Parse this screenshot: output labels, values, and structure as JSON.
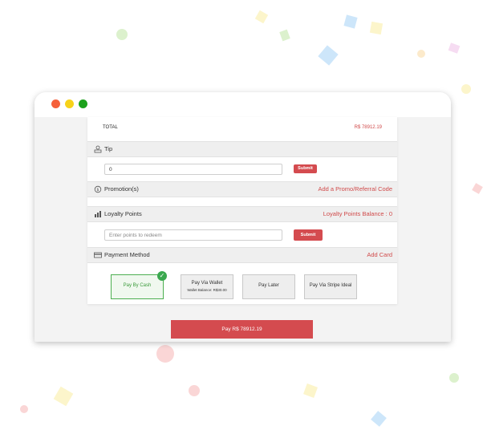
{
  "window": {
    "controls": [
      "close",
      "minimize",
      "maximize"
    ]
  },
  "summary": {
    "total_label": "TOTAL",
    "total_value": "R$ 78912.19"
  },
  "tip": {
    "title": "Tip",
    "icon": "tip-icon",
    "input_value": "0",
    "submit_label": "Submit"
  },
  "promotion": {
    "title": "Promotion(s)",
    "icon": "dollar-circle-icon",
    "link": "Add a Promo/Referral Code"
  },
  "loyalty": {
    "title": "Loyalty Points",
    "icon": "bar-chart-icon",
    "balance": "Loyalty Points Balance : 0",
    "placeholder": "Enter points to redeem",
    "submit_label": "Submit"
  },
  "payment": {
    "title": "Payment Method",
    "icon": "card-icon",
    "link": "Add Card",
    "options": [
      {
        "label": "Pay By Cash",
        "selected": true
      },
      {
        "label": "Pay Via Wallet",
        "sublabel": "Wallet Balance: R$30.00"
      },
      {
        "label": "Pay Later"
      },
      {
        "label": "Pay Via Stripe Ideal"
      }
    ]
  },
  "pay_button": "Pay R$ 78912.19",
  "colors": {
    "accent": "#d44b4f",
    "selected": "#4caf50",
    "dot_red": "#f5603a",
    "dot_yellow": "#f7d21a",
    "dot_green": "#1ca11c"
  }
}
